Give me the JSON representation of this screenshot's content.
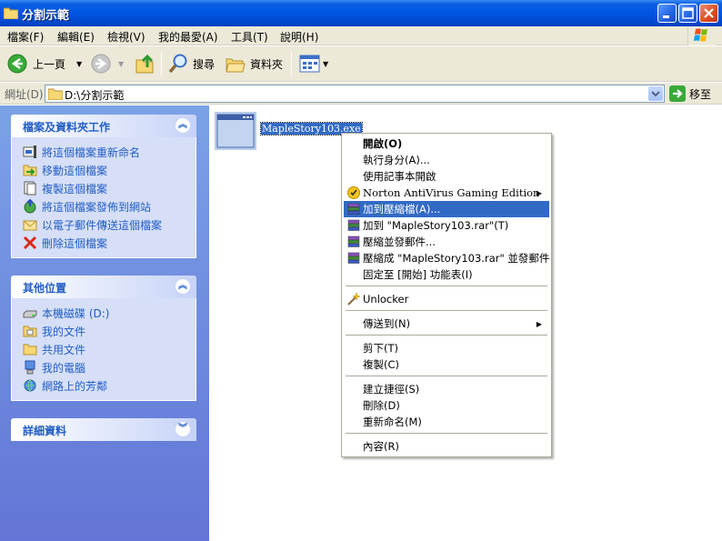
{
  "window": {
    "title": "分割示範"
  },
  "menubar": [
    "檔案(F)",
    "編輯(E)",
    "檢視(V)",
    "我的最愛(A)",
    "工具(T)",
    "說明(H)"
  ],
  "toolbar": {
    "back": "上一頁",
    "search": "搜尋",
    "folders": "資料夾"
  },
  "address": {
    "label": "網址(D)",
    "value": "D:\\分割示範",
    "go": "移至"
  },
  "file_tasks": {
    "title": "檔案及資料夾工作",
    "items": [
      "將這個檔案重新命名",
      "移動這個檔案",
      "複製這個檔案",
      "將這個檔案發佈到網站",
      "以電子郵件傳送這個檔案",
      "刪除這個檔案"
    ]
  },
  "other_places": {
    "title": "其他位置",
    "items": [
      "本機磁碟 (D:)",
      "我的文件",
      "共用文件",
      "我的電腦",
      "網路上的芳鄰"
    ]
  },
  "details": {
    "title": "詳細資料"
  },
  "file": {
    "name": "MapleStory103.exe"
  },
  "context_menu": {
    "open": "開啟(O)",
    "run_as": "執行身分(A)...",
    "notepad": "使用記事本開啟",
    "norton": "Norton AntiVirus Gaming Edition",
    "add_archive": "加到壓縮檔(A)...",
    "add_rar": "加到 \"MapleStory103.rar\"(T)",
    "compress_email": "壓縮並發郵件...",
    "compress_rar_email": "壓縮成 \"MapleStory103.rar\" 並發郵件",
    "pin_start": "固定至 [開始] 功能表(I)",
    "unlocker": "Unlocker",
    "send_to": "傳送到(N)",
    "cut": "剪下(T)",
    "copy": "複製(C)",
    "shortcut": "建立捷徑(S)",
    "delete": "刪除(D)",
    "rename": "重新命名(M)",
    "properties": "內容(R)"
  },
  "colors": {
    "titlebar": "#0054e3",
    "highlight": "#316ac5",
    "taskpane_link": "#215dc6"
  }
}
